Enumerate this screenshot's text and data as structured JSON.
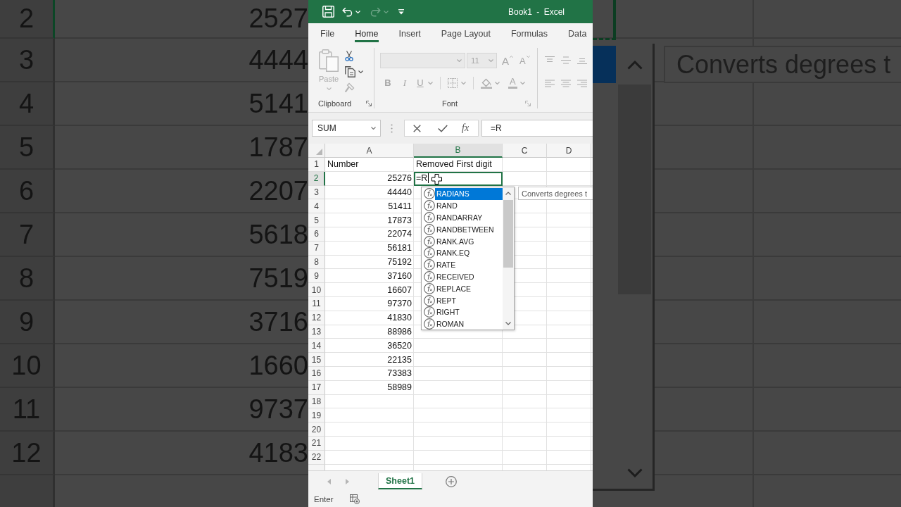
{
  "backdrop": {
    "left": {
      "rows": [
        {
          "number": "2",
          "value": "2527",
          "selected": true
        },
        {
          "number": "3",
          "value": "4444",
          "selected": false
        },
        {
          "number": "4",
          "value": "5141",
          "selected": false
        },
        {
          "number": "5",
          "value": "1787",
          "selected": false
        },
        {
          "number": "6",
          "value": "2207",
          "selected": false
        },
        {
          "number": "7",
          "value": "5618",
          "selected": false
        },
        {
          "number": "8",
          "value": "7519",
          "selected": false
        },
        {
          "number": "9",
          "value": "3716",
          "selected": false
        },
        {
          "number": "10",
          "value": "1660",
          "selected": false
        },
        {
          "number": "11",
          "value": "9737",
          "selected": false
        },
        {
          "number": "12",
          "value": "4183",
          "selected": false
        }
      ]
    },
    "right": {
      "tooltip": "Converts degrees t"
    }
  },
  "window": {
    "title": "Book1 - Excel"
  },
  "quick_access_toolbar": [
    {
      "kind": "save",
      "disabled": false
    },
    {
      "kind": "undo",
      "disabled": false
    },
    {
      "kind": "redo",
      "disabled": true
    },
    {
      "kind": "customize",
      "disabled": false
    }
  ],
  "ribbon": {
    "tabs": [
      {
        "label": "File",
        "selected": false
      },
      {
        "label": "Home",
        "selected": true
      },
      {
        "label": "Insert",
        "selected": false
      },
      {
        "label": "Page Layout",
        "selected": false
      },
      {
        "label": "Formulas",
        "selected": false
      },
      {
        "label": "Data",
        "selected": false
      }
    ],
    "clipboard": {
      "label": "Clipboard",
      "paste": {
        "label": "Paste",
        "disabled": true
      },
      "tools": [
        {
          "kind": "cut",
          "disabled": false
        },
        {
          "kind": "copy",
          "disabled": false
        },
        {
          "kind": "format_painter",
          "disabled": true
        }
      ]
    },
    "font": {
      "label": "Font",
      "disabled": true,
      "size": "11",
      "top_buttons": [
        {
          "kind": "grow",
          "glyph": "A"
        },
        {
          "kind": "shrink",
          "glyph": "A"
        }
      ],
      "bottom_buttons": [
        {
          "kind": "bold",
          "glyph": "B"
        },
        {
          "kind": "italic",
          "glyph": "I"
        },
        {
          "kind": "underline",
          "glyph": "U"
        },
        {
          "kind": "borders"
        },
        {
          "kind": "fill_color"
        },
        {
          "kind": "font_color",
          "glyph": "A"
        }
      ]
    },
    "alignment": {
      "disabled": true
    }
  },
  "formula_bar": {
    "name_box": "SUM",
    "insert_function": "fx",
    "formula": "=R"
  },
  "sheet": {
    "columns": [
      {
        "label": "A",
        "selected": false
      },
      {
        "label": "B",
        "selected": true
      },
      {
        "label": "C",
        "selected": false
      },
      {
        "label": "D",
        "selected": false
      }
    ],
    "rows": [
      {
        "number": "1",
        "selected": false,
        "cells": [
          {
            "kind": "text",
            "text": "Number",
            "active": false
          },
          {
            "kind": "text",
            "text": "Removed First digit",
            "active": false
          }
        ]
      },
      {
        "number": "2",
        "selected": true,
        "cells": [
          {
            "kind": "number",
            "text": "25276",
            "active": false
          },
          {
            "kind": "text",
            "text": "=R",
            "active": true
          }
        ]
      },
      {
        "number": "3",
        "selected": false,
        "cells": [
          {
            "kind": "number",
            "text": "44440",
            "active": false
          }
        ]
      },
      {
        "number": "4",
        "selected": false,
        "cells": [
          {
            "kind": "number",
            "text": "51411",
            "active": false
          }
        ]
      },
      {
        "number": "5",
        "selected": false,
        "cells": [
          {
            "kind": "number",
            "text": "17873",
            "active": false
          }
        ]
      },
      {
        "number": "6",
        "selected": false,
        "cells": [
          {
            "kind": "number",
            "text": "22074",
            "active": false
          }
        ]
      },
      {
        "number": "7",
        "selected": false,
        "cells": [
          {
            "kind": "number",
            "text": "56181",
            "active": false
          }
        ]
      },
      {
        "number": "8",
        "selected": false,
        "cells": [
          {
            "kind": "number",
            "text": "75192",
            "active": false
          }
        ]
      },
      {
        "number": "9",
        "selected": false,
        "cells": [
          {
            "kind": "number",
            "text": "37160",
            "active": false
          }
        ]
      },
      {
        "number": "10",
        "selected": false,
        "cells": [
          {
            "kind": "number",
            "text": "16607",
            "active": false
          }
        ]
      },
      {
        "number": "11",
        "selected": false,
        "cells": [
          {
            "kind": "number",
            "text": "97370",
            "active": false
          }
        ]
      },
      {
        "number": "12",
        "selected": false,
        "cells": [
          {
            "kind": "number",
            "text": "41830",
            "active": false
          }
        ]
      },
      {
        "number": "13",
        "selected": false,
        "cells": [
          {
            "kind": "number",
            "text": "88986",
            "active": false
          }
        ]
      },
      {
        "number": "14",
        "selected": false,
        "cells": [
          {
            "kind": "number",
            "text": "36520",
            "active": false
          }
        ]
      },
      {
        "number": "15",
        "selected": false,
        "cells": [
          {
            "kind": "number",
            "text": "22135",
            "active": false
          }
        ]
      },
      {
        "number": "16",
        "selected": false,
        "cells": [
          {
            "kind": "number",
            "text": "73383",
            "active": false
          }
        ]
      },
      {
        "number": "17",
        "selected": false,
        "cells": [
          {
            "kind": "number",
            "text": "58989",
            "active": false
          }
        ]
      },
      {
        "number": "18",
        "selected": false
      },
      {
        "number": "19",
        "selected": false
      },
      {
        "number": "20",
        "selected": false
      },
      {
        "number": "21",
        "selected": false
      },
      {
        "number": "22",
        "selected": false
      }
    ]
  },
  "autocomplete": {
    "items": [
      {
        "label": "RADIANS",
        "selected": true
      },
      {
        "label": "RAND",
        "selected": false
      },
      {
        "label": "RANDARRAY",
        "selected": false
      },
      {
        "label": "RANDBETWEEN",
        "selected": false
      },
      {
        "label": "RANK.AVG",
        "selected": false
      },
      {
        "label": "RANK.EQ",
        "selected": false
      },
      {
        "label": "RATE",
        "selected": false
      },
      {
        "label": "RECEIVED",
        "selected": false
      },
      {
        "label": "REPLACE",
        "selected": false
      },
      {
        "label": "REPT",
        "selected": false
      },
      {
        "label": "RIGHT",
        "selected": false
      },
      {
        "label": "ROMAN",
        "selected": false
      }
    ],
    "tooltip": "Converts degrees t"
  },
  "sheet_tabs": [
    {
      "label": "Sheet1",
      "selected": true
    }
  ],
  "status_bar": {
    "mode": "Enter"
  }
}
